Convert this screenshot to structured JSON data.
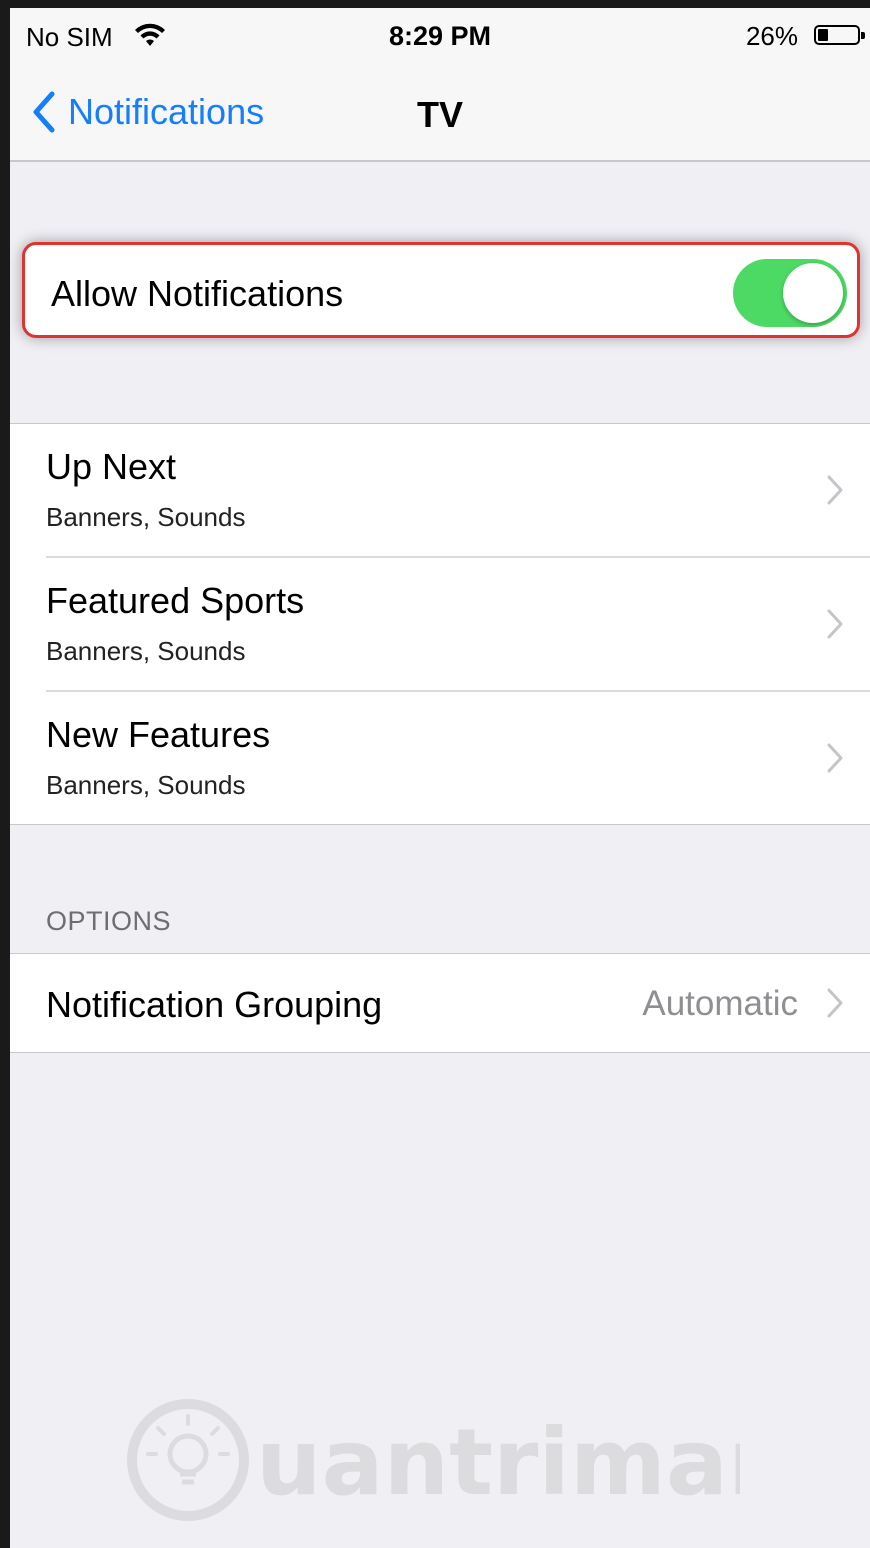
{
  "status_bar": {
    "carrier": "No SIM",
    "time": "8:29 PM",
    "battery": "26%"
  },
  "nav": {
    "back_label": "Notifications",
    "title": "TV"
  },
  "allow": {
    "label": "Allow Notifications",
    "enabled": true
  },
  "categories": [
    {
      "title": "Up Next",
      "subtitle": "Banners, Sounds"
    },
    {
      "title": "Featured Sports",
      "subtitle": "Banners, Sounds"
    },
    {
      "title": "New Features",
      "subtitle": "Banners, Sounds"
    }
  ],
  "options": {
    "header": "OPTIONS",
    "grouping_label": "Notification Grouping",
    "grouping_value": "Automatic"
  },
  "watermark": {
    "text": "uantrimang"
  },
  "colors": {
    "accent": "#147efb",
    "toggle_on": "#4cd964",
    "highlight": "#e0332f",
    "background": "#efeff4"
  }
}
